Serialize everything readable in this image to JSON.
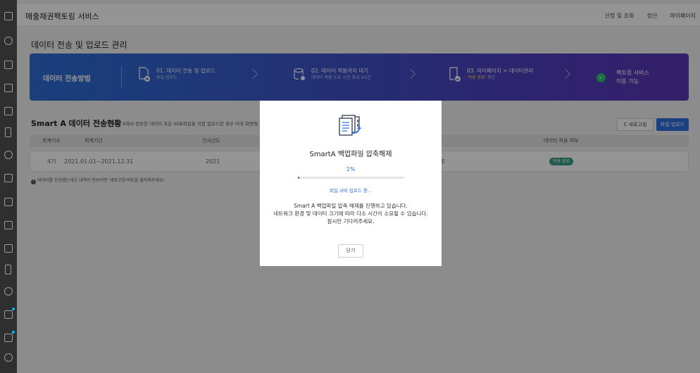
{
  "header": {
    "app_title": "매출채권팩토링 서비스",
    "nav": [
      "신청 및 조회",
      "정산",
      "마이페이지"
    ]
  },
  "page": {
    "title": "데이터 전송 및 업로드 관리"
  },
  "banner": {
    "label": "데이터 전송방법",
    "steps": [
      {
        "title": "01. 데이터 전송 및 업로드",
        "sub": "파일 업로드"
      },
      {
        "title": "02. 데이터 적용까지 대기",
        "sub": "데이터 적용 소요 시간 최대 3시간"
      },
      {
        "title": "03. 마이페이지 > 데이터관리",
        "sub_highlight": "'적용 완료'",
        "sub_rest": " 확인"
      }
    ],
    "final_line1": "팩토링 서비스",
    "final_line2": "이용 가능",
    "check_icon": "✓"
  },
  "section": {
    "title": "Smart A 데이터 전송현황",
    "note": "Smart A에서 전송한 데이터 혹은 SDB파일을 직접 업로드한 경우 아래 화면에서",
    "refresh_label": "C 새로고침",
    "upload_label": "파일 업로드",
    "info_mark": "!",
    "info": "데이터를 전송했는데도 내역이 안보이면 '새로고침'버튼을 클릭해주세요!"
  },
  "table": {
    "columns": [
      "회계기수",
      "회계기간",
      "인사년도",
      "데이터 적용 여부"
    ],
    "rows": [
      {
        "term": "4기",
        "period": "2021.01.01~2021.12.31",
        "year": "2021",
        "hidden_fragment": "E",
        "status": "적용 완료"
      }
    ]
  },
  "modal": {
    "title": "SmartA 백업파일 압축해제",
    "progress_text": "1%",
    "progress_value": 0.01,
    "status": "파일 서버 업로드 중...",
    "message_line1": "Smart A 백업파일 압축 해제를 진행하고 있습니다.",
    "message_line2": "네트워크 환경 및 데이터 크기에 따라 다소 시간이 소요될 수 있습니다.",
    "message_line3": "잠시만 기다려주세요.",
    "close_label": "닫기"
  },
  "colors": {
    "accent": "#2f6fe0",
    "banner_start": "#2d6ed6",
    "banner_end": "#5a36b6",
    "status_badge": "#3a9e88",
    "sidebar": "#2f2f2f"
  }
}
